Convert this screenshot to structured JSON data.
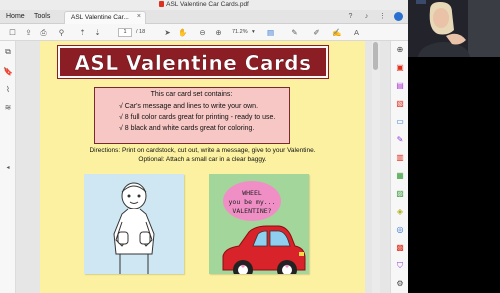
{
  "window": {
    "title": "ASL Valentine Car Cards.pdf"
  },
  "menu": {
    "home": "Home",
    "tools": "Tools"
  },
  "tab": {
    "label": "ASL Valentine Car...",
    "close": "×"
  },
  "toolbar": {
    "page_current": "1",
    "page_total": "/ 18",
    "zoom": "71.2%",
    "zoom_arrow": "▾"
  },
  "document": {
    "banner_title": "ASL Valentine Cards",
    "info_heading": "This car card set contains:",
    "info_items": [
      "√ Car's message and lines to write your own.",
      "√ 8 full color cards great for printing - ready to use.",
      "√ 8 black and white cards great for coloring."
    ],
    "directions_line1": "Directions: Print on cardstock, cut out, write a message, give to your Valentine.",
    "directions_line2": "Optional: Attach a small car in a clear baggy.",
    "bubble_lines": [
      "WHEEL",
      "you be my...",
      "VALENTINE?"
    ]
  },
  "colors": {
    "page_bg": "#fbf1a0",
    "banner": "#8b1d24",
    "info_box": "#f6c7c4",
    "card_blue": "#cfe7f2",
    "card_green": "#a3d69a",
    "bubble_pink": "#f08fc6",
    "car_red": "#d8232a"
  },
  "icons": {
    "toolbar": [
      "new-file-icon",
      "upload-icon",
      "print-icon",
      "search-icon",
      "page-up-icon",
      "page-down-icon",
      "select-cursor-icon",
      "hand-icon",
      "zoom-out-icon",
      "zoom-in-icon",
      "page-layout-icon",
      "comment-icon",
      "highlight-icon",
      "draw-icon"
    ],
    "right_rail": [
      "zoom-tool-icon",
      "export-pdf-icon",
      "edit-pdf-icon",
      "create-pdf-icon",
      "comment-icon",
      "combine-icon",
      "organize-icon",
      "scan-icon",
      "fill-sign-icon",
      "protect-icon",
      "more-tools-icon"
    ]
  }
}
